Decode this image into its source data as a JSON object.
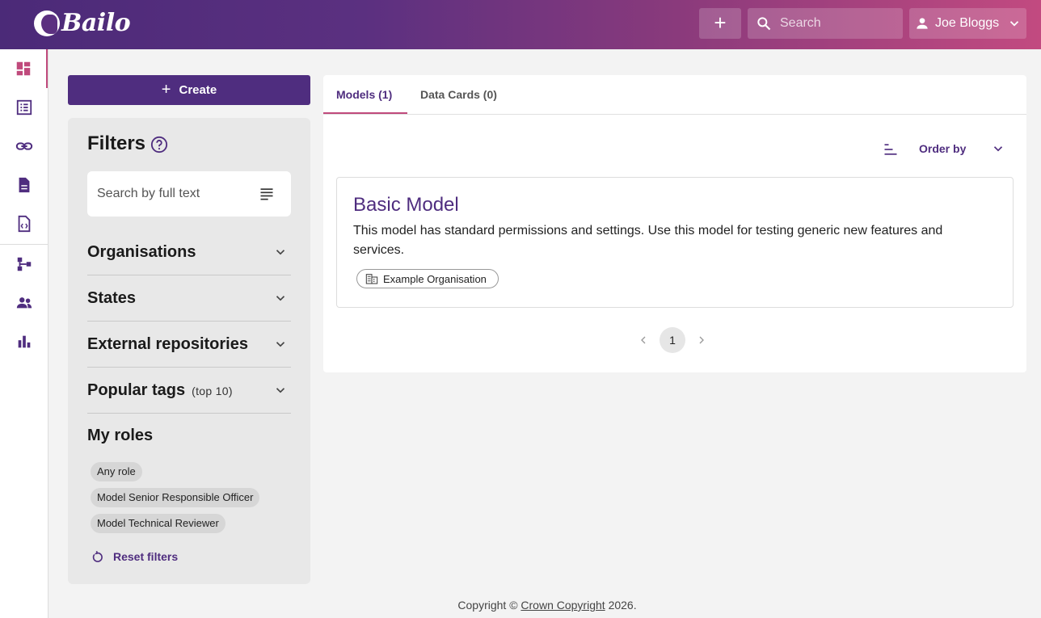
{
  "header": {
    "logo_text": "Bailo",
    "search_placeholder": "Search",
    "user_name": "Joe Bloggs"
  },
  "rail": {
    "items": [
      "dashboard-icon",
      "list-icon",
      "link-icon",
      "document-icon",
      "code-file-icon",
      "schema-icon",
      "people-icon",
      "bar-chart-icon"
    ],
    "active_index": 0
  },
  "create_button": {
    "label": "Create"
  },
  "filters": {
    "title": "Filters",
    "search_placeholder": "Search by full text",
    "sections": [
      {
        "label": "Organisations",
        "sub": ""
      },
      {
        "label": "States",
        "sub": ""
      },
      {
        "label": "External repositories",
        "sub": ""
      },
      {
        "label": "Popular tags",
        "sub": "(top 10)"
      }
    ],
    "roles_title": "My roles",
    "roles": [
      "Any role",
      "Model Senior Responsible Officer",
      "Model Technical Reviewer"
    ],
    "reset_label": "Reset filters"
  },
  "main": {
    "tabs": [
      {
        "label": "Models (1)"
      },
      {
        "label": "Data Cards (0)"
      }
    ],
    "order_by_label": "Order by",
    "models": [
      {
        "title": "Basic Model",
        "description": "This model has standard permissions and settings. Use this model for testing generic new features and services.",
        "organisation": "Example Organisation"
      }
    ],
    "current_page": "1"
  },
  "footer": {
    "prefix": "Copyright ©",
    "link": "Crown Copyright",
    "suffix": "2026."
  },
  "colors": {
    "primary": "#4f2d7f",
    "accent": "#c04a7c"
  }
}
